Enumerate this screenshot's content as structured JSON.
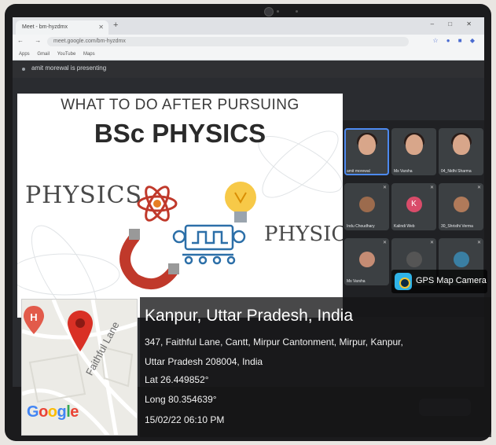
{
  "browser": {
    "tab_title": "Meet - bm-hyzdmx",
    "tab_close": "✕",
    "new_tab": "+",
    "window_controls": "– □ ✕",
    "nav": "← → C",
    "url": "meet.google.com/bm-hyzdmx",
    "extensions": "☆ ● ■ ◆",
    "bookmarks": [
      "Apps",
      "Gmail",
      "YouTube",
      "Maps"
    ]
  },
  "meet": {
    "presenting_text": "amit morewal is presenting"
  },
  "slide": {
    "heading": "WHAT TO DO AFTER PURSUING",
    "subject": "BSc PHYSICS",
    "word_left": "PHYSICS",
    "word_right": "PHYSICS"
  },
  "participants": [
    {
      "name": "amit morewal",
      "type": "video",
      "active": true
    },
    {
      "name": "Ms Varsha",
      "type": "video"
    },
    {
      "name": "04_Nidhi Sharma",
      "type": "video"
    },
    {
      "name": "Indu Choudhary",
      "type": "avatar",
      "initial": "",
      "color": "#9c6b4d"
    },
    {
      "name": "Kalindi Web",
      "type": "avatar",
      "initial": "K",
      "color": "#d94c6a"
    },
    {
      "name": "30_Shristhi Verma",
      "type": "avatar",
      "initial": "",
      "color": "#b07a5a"
    },
    {
      "name": "Ms Varsha",
      "type": "avatar",
      "initial": "",
      "color": "#c58c74"
    },
    {
      "name": "",
      "type": "avatar",
      "initial": "",
      "color": "#555"
    },
    {
      "name": "",
      "type": "avatar",
      "initial": "",
      "color": "#3a7fa3"
    }
  ],
  "gps_badge": {
    "label": "GPS Map Camera",
    "icon": "camera-lens-icon"
  },
  "location": {
    "city": "Kanpur, Uttar Pradesh, India",
    "address_line1": "347, Faithful Lane, Cantt, Mirpur Cantonment, Mirpur, Kanpur,",
    "address_line2": "Uttar Pradesh 208004, India",
    "lat": "Lat 26.449852°",
    "long": "Long 80.354639°",
    "datetime": "15/02/22 06:10 PM"
  },
  "map": {
    "street_label": "Faithful Lane",
    "brand": [
      "G",
      "o",
      "o",
      "g",
      "l",
      "e"
    ],
    "hospital_pin_letter": "H"
  }
}
